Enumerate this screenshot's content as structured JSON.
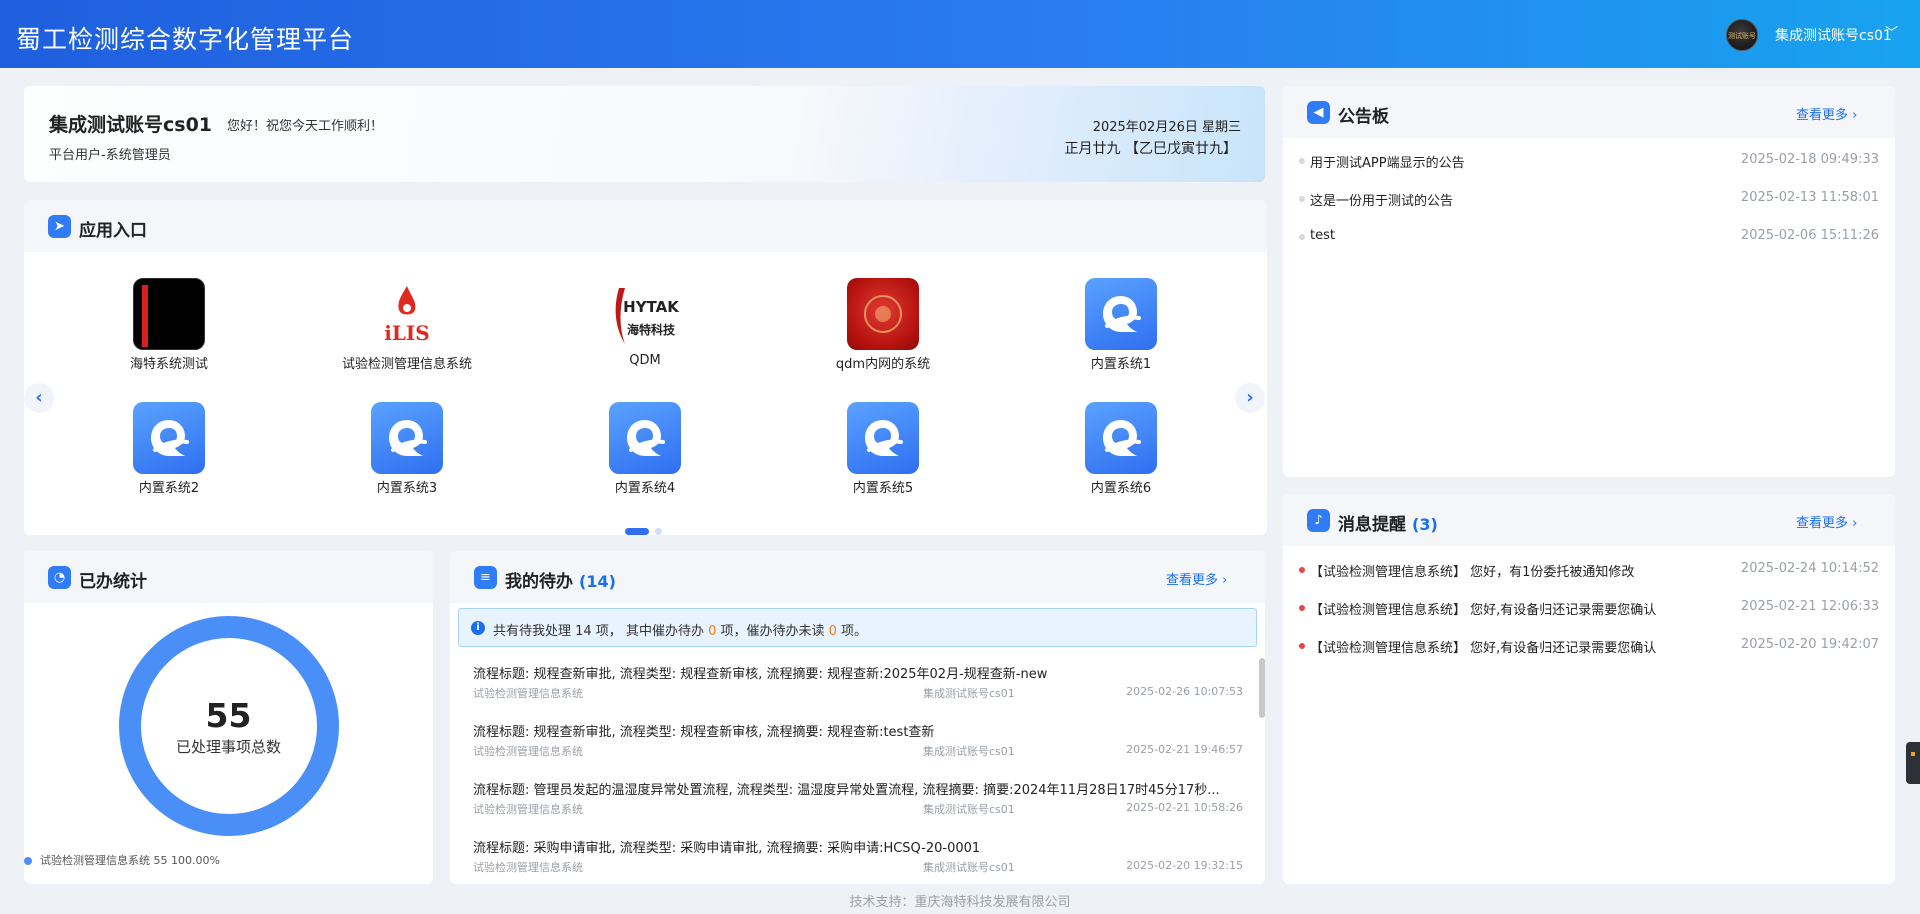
{
  "header": {
    "title": "蜀工检测综合数字化管理平台",
    "user": "集成测试账号cs01",
    "avatar_text": "测试账号"
  },
  "welcome": {
    "name": "集成测试账号cs01",
    "greeting": "您好！祝您今天工作顺利！",
    "role": "平台用户-系统管理员",
    "date": "2025年02月26日 星期三",
    "lunar": "正月廿九 【乙巳戊寅廿九】"
  },
  "apps": {
    "title": "应用入口",
    "items": [
      {
        "name": "海特系统测试",
        "logo": "black-red-logo"
      },
      {
        "name": "试验检测管理信息系统",
        "logo": "ilis-logo",
        "logo_text": "iLIS"
      },
      {
        "name": "QDM",
        "logo": "hytak-logo",
        "logo_text": "HYTAK",
        "logo_sub": "海特科技"
      },
      {
        "name": "qdm内网的系统",
        "logo": "red-logo"
      },
      {
        "name": "内置系统1",
        "logo": "builtin-logo"
      },
      {
        "name": "内置系统2",
        "logo": "builtin-logo"
      },
      {
        "name": "内置系统3",
        "logo": "builtin-logo"
      },
      {
        "name": "内置系统4",
        "logo": "builtin-logo"
      },
      {
        "name": "内置系统5",
        "logo": "builtin-logo"
      },
      {
        "name": "内置系统6",
        "logo": "builtin-logo"
      }
    ],
    "page": 1,
    "pages": 2
  },
  "stats": {
    "title": "已办统计",
    "total": "55",
    "total_label": "已处理事项总数",
    "legend": "试验检测管理信息系统 55 100.00%",
    "share": 1.0,
    "color": "#4a8ff8"
  },
  "todo": {
    "title": "我的待办",
    "count": "(14)",
    "more": "查看更多",
    "notice_a": "共有待我处理 14 项， 其中催办待办 ",
    "urge_count": "0",
    "notice_b": " 项，催办待办未读 ",
    "unread_count": "0",
    "notice_c": " 项。",
    "items": [
      {
        "title": "流程标题: 规程查新审批, 流程类型: 规程查新审核, 流程摘要: 规程查新:2025年02月-规程查新-new",
        "system": "试验检测管理信息系统",
        "user": "集成测试账号cs01",
        "time": "2025-02-26 10:07:53"
      },
      {
        "title": "流程标题: 规程查新审批, 流程类型: 规程查新审核, 流程摘要: 规程查新:test查新",
        "system": "试验检测管理信息系统",
        "user": "集成测试账号cs01",
        "time": "2025-02-21 19:46:57"
      },
      {
        "title": "流程标题: 管理员发起的温湿度异常处置流程, 流程类型: 温湿度异常处置流程, 流程摘要: 摘要:2024年11月28日17时45分17秒...",
        "system": "试验检测管理信息系统",
        "user": "集成测试账号cs01",
        "time": "2025-02-21 10:58:26"
      },
      {
        "title": "流程标题: 采购申请审批, 流程类型: 采购申请审批, 流程摘要: 采购申请:HCSQ-20-0001",
        "system": "试验检测管理信息系统",
        "user": "集成测试账号cs01",
        "time": "2025-02-20 19:32:15"
      }
    ]
  },
  "bulletin": {
    "title": "公告板",
    "more": "查看更多",
    "items": [
      {
        "text": "用于测试APP端显示的公告",
        "time": "2025-02-18 09:49:33"
      },
      {
        "text": "这是一份用于测试的公告",
        "time": "2025-02-13 11:58:01"
      },
      {
        "text": "test",
        "time": "2025-02-06 15:11:26"
      }
    ]
  },
  "messages": {
    "title": "消息提醒",
    "count": "(3)",
    "more": "查看更多",
    "items": [
      {
        "text": "【试验检测管理信息系统】 您好，有1份委托被通知修改",
        "time": "2025-02-24 10:14:52"
      },
      {
        "text": "【试验检测管理信息系统】 您好,有设备归还记录需要您确认",
        "time": "2025-02-21 12:06:33"
      },
      {
        "text": "【试验检测管理信息系统】 您好,有设备归还记录需要您确认",
        "time": "2025-02-20 19:42:07"
      }
    ]
  },
  "footer": "技术支持：重庆海特科技发展有限公司"
}
